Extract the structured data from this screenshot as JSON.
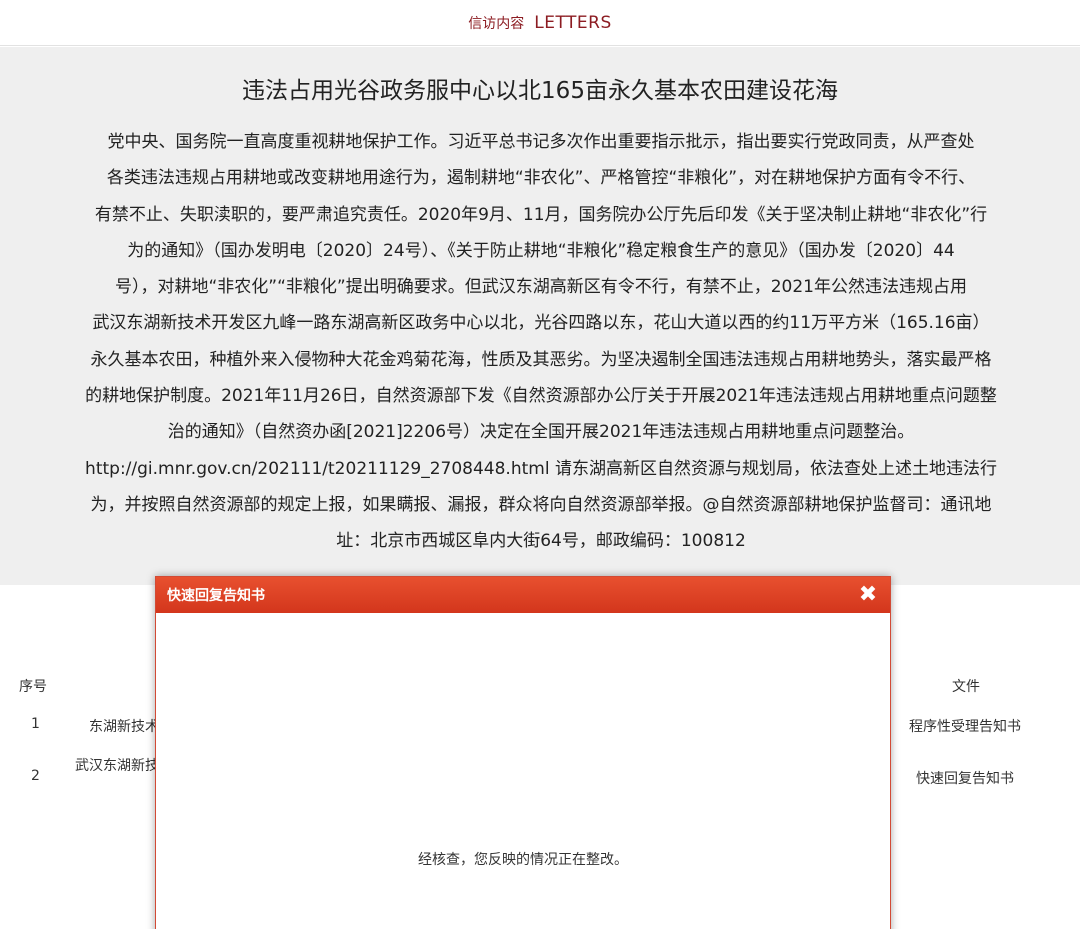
{
  "header": {
    "title_cn": "信访内容",
    "title_en": "LETTERS"
  },
  "letter": {
    "title": "违法占用光谷政务服中心以北165亩永久基本农田建设花海",
    "body_lines": [
      "党中央、国务院一直高度重视耕地保护工作。习近平总书记多次作出重要指示批示，指出要实行党政同责，从严查处",
      "各类违法违规占用耕地或改变耕地用途行为，遏制耕地“非农化”、严格管控“非粮化”，对在耕地保护方面有令不行、",
      "有禁不止、失职渎职的，要严肃追究责任。2020年9月、11月，国务院办公厅先后印发《关于坚决制止耕地“非农化”行",
      "为的通知》（国办发明电〔2020〕24号）、《关于防止耕地“非粮化”稳定粮食生产的意见》（国办发〔2020〕44",
      "号），对耕地“非农化”“非粮化”提出明确要求。但武汉东湖高新区有令不行，有禁不止，2021年公然违法违规占用",
      "武汉东湖新技术开发区九峰一路东湖高新区政务中心以北，光谷四路以东，花山大道以西的约11万平方米（165.16亩）",
      "永久基本农田，种植外来入侵物种大花金鸡菊花海，性质及其恶劣。为坚决遏制全国违法违规占用耕地势头，落实最严格",
      "的耕地保护制度。2021年11月26日，自然资源部下发《自然资源部办公厅关于开展2021年违法违规占用耕地重点问题整",
      "治的通知》（自然资办函[2021]2206号）决定在全国开展2021年违法违规占用耕地重点问题整治。",
      "http://gi.mnr.gov.cn/202111/t20211129_2708448.html 请东湖高新区自然资源与规划局，依法查处上述土地违法行",
      "为，并按照自然资源部的规定上报，如果瞒报、漏报，群众将向自然资源部举报。@自然资源部耕地保护监督司：通讯地",
      "址：北京市西城区阜内大街64号，邮政编码：100812"
    ]
  },
  "table": {
    "headers": {
      "index": "序号",
      "file": "文件"
    },
    "rows": [
      {
        "index": "1",
        "unit": "东湖新技术",
        "file": "程序性受理告知书"
      },
      {
        "index": "2",
        "unit": "武汉东湖新技",
        "file": "快速回复告知书"
      }
    ]
  },
  "modal": {
    "title": "快速回复告知书",
    "close_symbol": "✖",
    "message": "经核查，您反映的情况正在整改。"
  },
  "colors": {
    "accent": "#8c1c22",
    "modal_header": "#dc3d22",
    "panel_bg": "#efefef"
  }
}
